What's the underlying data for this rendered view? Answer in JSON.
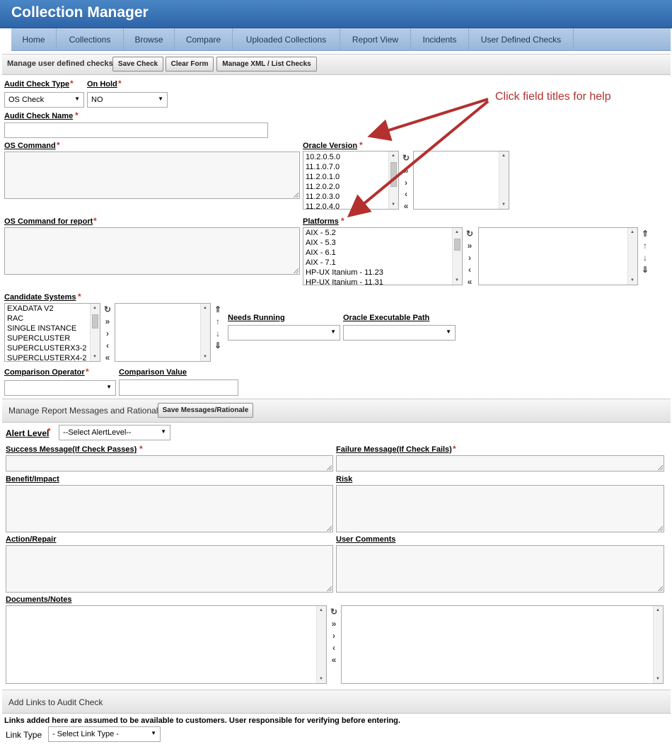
{
  "app": {
    "title": "Collection Manager"
  },
  "nav": {
    "tabs": [
      "Home",
      "Collections",
      "Browse",
      "Compare",
      "Uploaded Collections",
      "Report View",
      "Incidents",
      "User Defined Checks"
    ]
  },
  "manage": {
    "title": "Manage user defined checks",
    "save": "Save Check",
    "clear": "Clear Form",
    "xml": "Manage XML / List Checks"
  },
  "fields": {
    "audit_type": {
      "label": "Audit Check Type",
      "value": "OS Check"
    },
    "on_hold": {
      "label": "On Hold",
      "value": "NO"
    },
    "check_name": {
      "label": "Audit Check Name"
    },
    "os_command": {
      "label": "OS Command"
    },
    "oracle_version": {
      "label": "Oracle Version",
      "options": [
        "10.2.0.5.0",
        "11.1.0.7.0",
        "11.2.0.1.0",
        "11.2.0.2.0",
        "11.2.0.3.0",
        "11.2.0.4.0"
      ]
    },
    "os_report": {
      "label": "OS Command for report"
    },
    "platforms": {
      "label": "Platforms",
      "options": [
        "AIX - 5.2",
        "AIX - 5.3",
        "AIX - 6.1",
        "AIX - 7.1",
        "HP-UX Itanium - 11.23",
        "HP-UX Itanium - 11.31"
      ]
    },
    "candidate": {
      "label": "Candidate Systems",
      "options": [
        "EXADATA V2",
        "RAC",
        "SINGLE INSTANCE",
        "SUPERCLUSTER",
        "SUPERCLUSTERX3-2",
        "SUPERCLUSTERX4-2"
      ]
    },
    "needs_running": {
      "label": "Needs Running"
    },
    "oracle_exec": {
      "label": "Oracle Executable Path"
    },
    "comp_op": {
      "label": "Comparison Operator"
    },
    "comp_val": {
      "label": "Comparison Value"
    }
  },
  "annotation": "Click field titles for help",
  "report": {
    "title": "Manage Report Messages and Rationale",
    "save": "Save Messages/Rationale",
    "alert": {
      "label": "Alert Level",
      "value": "--Select AlertLevel--"
    },
    "success": "Success Message(If Check Passes)",
    "failure": "Failure Message(If Check Fails)",
    "benefit": "Benefit/Impact",
    "risk": "Risk",
    "action": "Action/Repair",
    "comments": "User Comments",
    "docs": "Documents/Notes"
  },
  "links": {
    "title": "Add Links to Audit Check",
    "notice": "Links added here are assumed to be available to customers. User responsible for verifying before entering.",
    "type_label": "Link Type",
    "type_value": "- Select Link Type -"
  },
  "colors": {
    "header": "#2d64a8",
    "nav": "#b6cde7",
    "annotation": "#b3302f",
    "required": "#c0392b"
  }
}
